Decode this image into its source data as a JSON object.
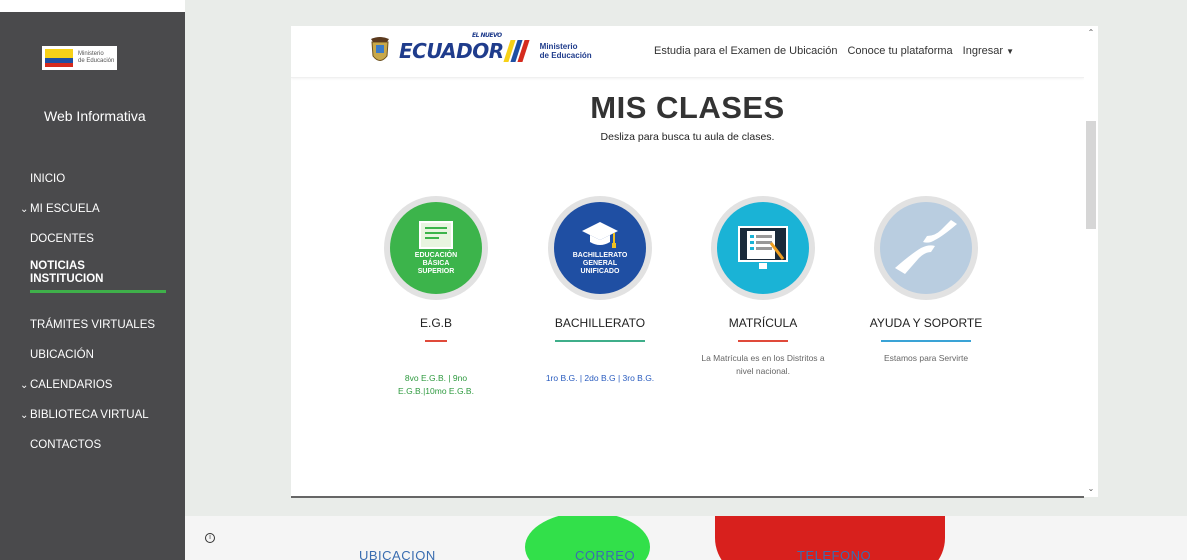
{
  "sidebar": {
    "logo_text_line1": "Ministerio",
    "logo_text_line2": "de Educación",
    "site_title": "Web Informativa",
    "items": [
      {
        "label": "INICIO"
      },
      {
        "label": "MI ESCUELA",
        "caret": "expand"
      },
      {
        "label": "DOCENTES"
      },
      {
        "label": "NOTICIAS INSTITUCION",
        "active": true
      },
      {
        "label": "TRÁMITES VIRTUALES"
      },
      {
        "label": "UBICACIÓN"
      },
      {
        "label": "CALENDARIOS",
        "caret": "expand"
      },
      {
        "label": "BIBLIOTECA VIRTUAL",
        "caret": "expand"
      },
      {
        "label": "CONTACTOS"
      }
    ],
    "active_color": "#3fb04a"
  },
  "header": {
    "brand_word": "ECUADOR",
    "brand_small": "EL NUEVO",
    "ministerio_line1": "Ministerio",
    "ministerio_line2": "de Educación",
    "links": [
      "Estudia para el Examen de Ubicación",
      "Conoce tu plataforma",
      "Ingresar"
    ]
  },
  "main": {
    "title": "MIS CLASES",
    "subtitle": "Desliza para busca tu aula de clases.",
    "columns": [
      {
        "title": "E.G.B",
        "circle_label": "EDUCACIÓN BÁSICA SUPERIOR",
        "desc": "8vo E.G.B. | 9no E.G.B.|10mo E.G.B.",
        "desc_color": "#2e9a3f",
        "accent": "#e04a3a",
        "circle_color": "#3cb44b",
        "icon": "certificate-icon"
      },
      {
        "title": "BACHILLERATO",
        "circle_label": "BACHILLERATO GENERAL UNIFICADO",
        "desc": "1ro B.G. | 2do B.G | 3ro B.G.",
        "desc_color": "#2a5cbf",
        "accent": "#3fae8a",
        "circle_color": "#1f4fa3",
        "icon": "graduation-cap-icon"
      },
      {
        "title": "MATRÍCULA",
        "circle_label": "",
        "desc": "La Matrícula es en los Distritos a nivel nacional.",
        "desc_color": "#666666",
        "accent": "#e04a3a",
        "circle_color": "#1ab3d6",
        "icon": "monitor-form-icon"
      },
      {
        "title": "AYUDA Y SOPORTE",
        "circle_label": "",
        "desc": "Estamos para Servirte",
        "desc_color": "#666666",
        "accent": "#3aa3d6",
        "circle_color": "#b9cde0",
        "icon": "helping-hands-icon"
      }
    ]
  },
  "bottom": {
    "labels": [
      "UBICACION",
      "CORREO",
      "TELEFONO"
    ]
  }
}
